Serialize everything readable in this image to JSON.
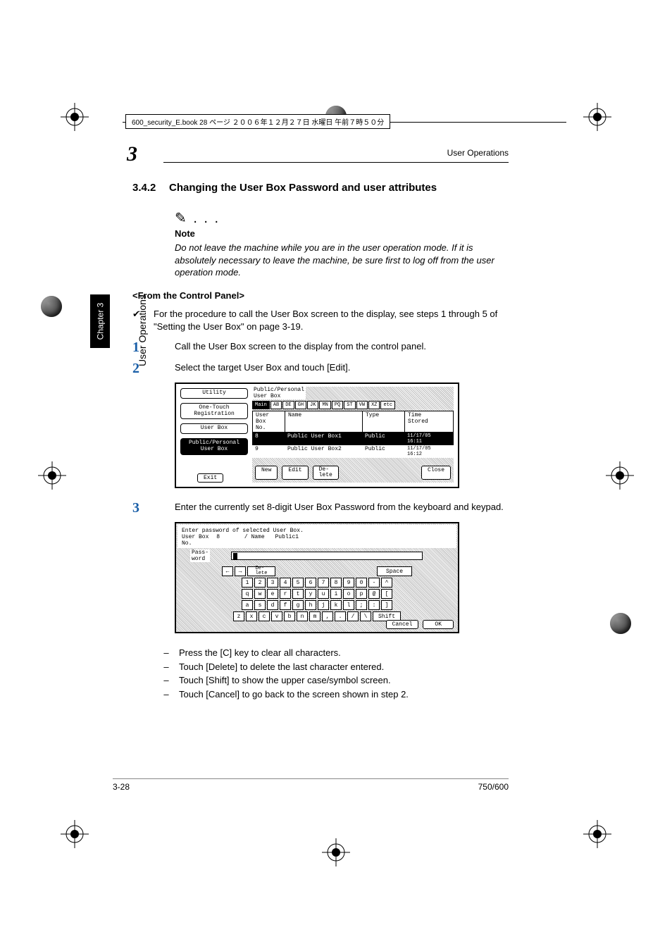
{
  "header_file": "600_security_E.book 28 ページ ２００６年１２月２７日 水曜日 午前７時５０分",
  "running_head": "User Operations",
  "chapter_big_number": "3",
  "side_tab": "Chapter 3",
  "side_label": "User Operations",
  "section": {
    "num": "3.4.2",
    "title": "Changing the User Box Password and user attributes"
  },
  "note": {
    "icon": "✎ . . .",
    "label": "Note",
    "body": "Do not leave the machine while you are in the user operation mode. If it is absolutely necessary to leave the machine, be sure first to log off from the user operation mode."
  },
  "subhead": "<From the Control Panel>",
  "bullet": "For the procedure to call the User Box screen to the display, see steps 1 through 5 of \"Setting the User Box\" on page 3-19.",
  "steps": {
    "s1": "Call the User Box screen to the display from the control panel.",
    "s2": "Select the target User Box and touch [Edit].",
    "s3": "Enter the currently set 8-digit User Box Password from the keyboard and keypad."
  },
  "subbullets": {
    "a": "Press the [C] key to clear all characters.",
    "b": "Touch [Delete] to delete the last character entered.",
    "c": "Touch [Shift] to show the upper case/symbol screen.",
    "d": "Touch [Cancel] to go back to the screen shown in step 2."
  },
  "shot1": {
    "title": "Public/Personal\nUser Box",
    "left": {
      "utility": "Utility",
      "onetouch": "One-Touch\nRegistration",
      "userbox": "User Box",
      "pubpers": "Public/Personal\nUser Box",
      "exit": "Exit"
    },
    "tabs": [
      "Main",
      "AB",
      "DE",
      "GH",
      "JK",
      "MN",
      "PQ",
      "ST",
      "VW",
      "XZ",
      "etc"
    ],
    "cols": {
      "no": "User Box\nNo.",
      "name": "Name",
      "type": "Type",
      "time": "Time\nStored"
    },
    "rows": [
      {
        "no": "8",
        "name": "Public User Box1",
        "type": "Public",
        "time": "11/17/05\n16:11"
      },
      {
        "no": "9",
        "name": "Public User Box2",
        "type": "Public",
        "time": "11/17/05\n16:12"
      }
    ],
    "btns": {
      "new": "New",
      "edit": "Edit",
      "del": "De-\nlete",
      "close": "Close"
    }
  },
  "shot2": {
    "line1": "Enter password of selected User Box.",
    "line2a": "User Box\nNo.",
    "line2a_val": "8",
    "line2b": "/ Name",
    "line2b_val": "Public1",
    "pwlabel": "Pass-\nword",
    "keys_top": [
      "←",
      "→",
      "De-\nlete"
    ],
    "space": "Space",
    "row_num": [
      "1",
      "2",
      "3",
      "4",
      "5",
      "6",
      "7",
      "8",
      "9",
      "0",
      "-",
      "^"
    ],
    "row_q": [
      "q",
      "w",
      "e",
      "r",
      "t",
      "y",
      "u",
      "i",
      "o",
      "p",
      "@",
      "["
    ],
    "row_a": [
      "a",
      "s",
      "d",
      "f",
      "g",
      "h",
      "j",
      "k",
      "l",
      ";",
      ":",
      "]"
    ],
    "row_z": [
      "z",
      "x",
      "c",
      "v",
      "b",
      "n",
      "m",
      ",",
      ".",
      "/",
      "\\"
    ],
    "shift": "Shift",
    "cancel": "Cancel",
    "ok": "OK"
  },
  "footer": {
    "left": "3-28",
    "right": "750/600"
  }
}
